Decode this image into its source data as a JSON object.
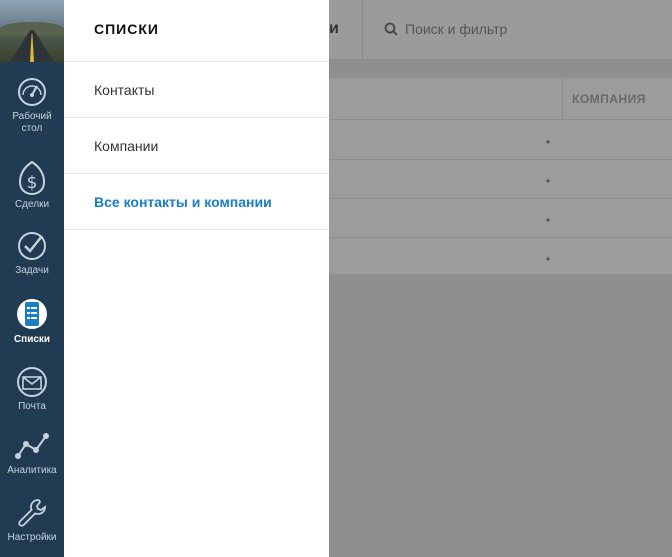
{
  "nav": {
    "items": [
      {
        "label": "Рабочий стол",
        "icon": "speedometer-icon",
        "active": false
      },
      {
        "label": "Сделки",
        "icon": "dollar-icon",
        "active": false
      },
      {
        "label": "Задачи",
        "icon": "checkmark-icon",
        "active": false
      },
      {
        "label": "Списки",
        "icon": "list-icon",
        "active": true
      },
      {
        "label": "Почта",
        "icon": "mail-icon",
        "active": false
      },
      {
        "label": "Аналитика",
        "icon": "analytics-icon",
        "active": false
      },
      {
        "label": "Настройки",
        "icon": "wrench-icon",
        "active": false
      }
    ],
    "desktop_line1": "Рабочий",
    "desktop_line2": "стол"
  },
  "drawer": {
    "title": "СПИСКИ",
    "items": [
      {
        "label": "Контакты",
        "selected": false
      },
      {
        "label": "Компании",
        "selected": false
      },
      {
        "label": "Все контакты и компании",
        "selected": true
      }
    ]
  },
  "background": {
    "search_placeholder": "Поиск и фильтр",
    "title_tail": "и",
    "column_header": "КОМПАНИЯ",
    "row_markers": [
      "•",
      "•",
      "•",
      "•"
    ]
  },
  "colors": {
    "rail": "#213c52",
    "accent": "#1a7ec2",
    "overlay": "#8f8f8f"
  }
}
